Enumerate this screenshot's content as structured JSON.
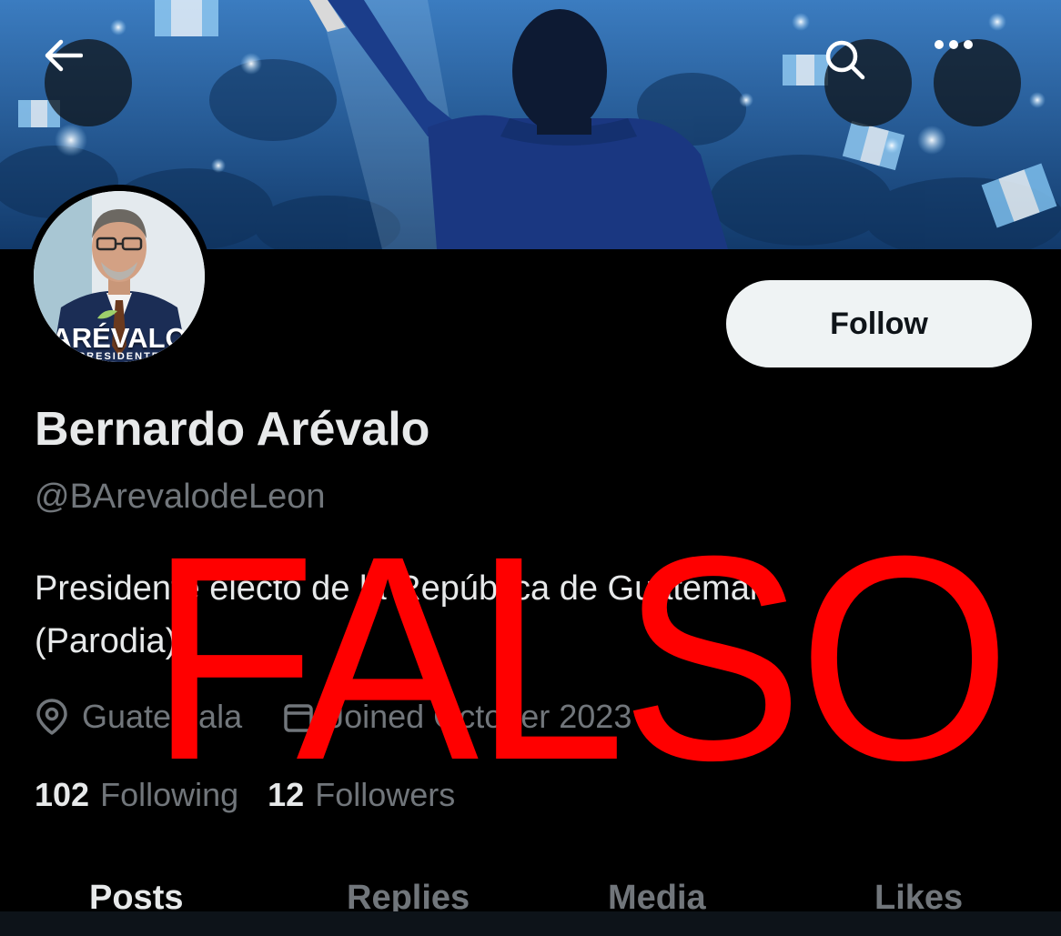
{
  "header": {
    "back_label": "back-arrow",
    "search_icon": "search-icon",
    "more_icon": "more-icon"
  },
  "profile": {
    "avatar_brand": "ARÉVALO",
    "avatar_brand_sub": "PRESIDENTE",
    "follow_label": "Follow",
    "display_name": "Bernardo Arévalo",
    "handle": "@BArevalodeLeon",
    "bio_lines": [
      "Presidente electo de la República de Guatemala",
      "(Parodia)"
    ],
    "location": "Guatemala",
    "joined": "Joined October 2023",
    "following_count": "102",
    "following_label": "Following",
    "followers_count": "12",
    "followers_label": "Followers"
  },
  "tabs": [
    {
      "label": "Posts",
      "active": true
    },
    {
      "label": "Replies",
      "active": false
    },
    {
      "label": "Media",
      "active": false
    },
    {
      "label": "Likes",
      "active": false
    }
  ],
  "overlay": {
    "stamp_text": "FALSO",
    "stamp_color": "#ff0000"
  },
  "colors": {
    "background": "#000000",
    "primary_text": "#e7e9ea",
    "secondary_text": "#71767b",
    "follow_button_bg": "#eff3f4"
  }
}
